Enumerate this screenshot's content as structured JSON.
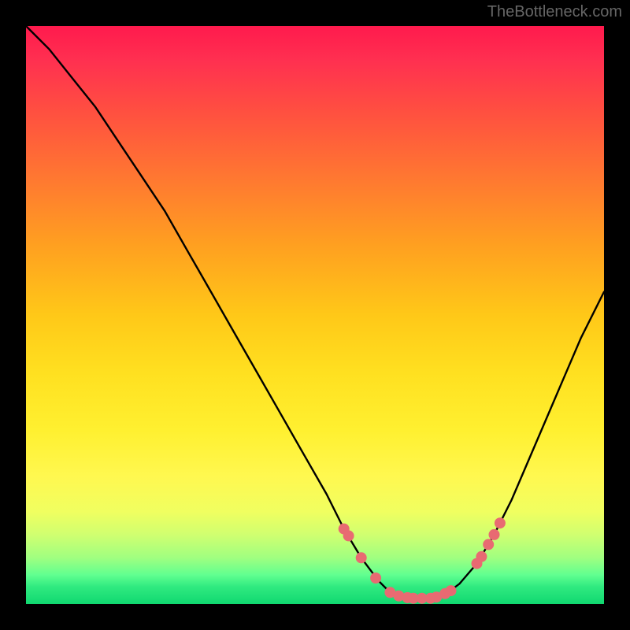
{
  "watermark": "TheBottleneck.com",
  "chart_data": {
    "type": "line",
    "title": "",
    "xlabel": "",
    "ylabel": "",
    "xlim": [
      0,
      100
    ],
    "ylim": [
      0,
      100
    ],
    "curve": {
      "name": "bottleneck-curve",
      "x": [
        0,
        4,
        8,
        12,
        16,
        20,
        24,
        28,
        32,
        36,
        40,
        44,
        48,
        52,
        55,
        58,
        61,
        63,
        65,
        67,
        69,
        71,
        73,
        75,
        78,
        81,
        84,
        87,
        90,
        93,
        96,
        100
      ],
      "y": [
        100,
        96,
        91,
        86,
        80,
        74,
        68,
        61,
        54,
        47,
        40,
        33,
        26,
        19,
        13,
        8,
        4,
        2,
        1.2,
        1,
        1,
        1.2,
        2,
        3.5,
        7,
        12,
        18,
        25,
        32,
        39,
        46,
        54
      ]
    },
    "markers": {
      "name": "highlight-dots",
      "color": "#e86a72",
      "x": [
        55.0,
        55.8,
        58.0,
        60.5,
        63.0,
        64.5,
        66.0,
        67.0,
        68.5,
        70.0,
        71.0,
        72.5,
        73.5,
        78.0,
        78.8,
        80.0,
        81.0,
        82.0
      ],
      "y": [
        13.0,
        11.8,
        8.0,
        4.5,
        2.0,
        1.4,
        1.1,
        1.0,
        1.0,
        1.0,
        1.2,
        1.8,
        2.3,
        7.0,
        8.2,
        10.3,
        12.0,
        14.0
      ]
    },
    "gradient_stops": [
      {
        "pos": 0.0,
        "color": "#ff1a4d"
      },
      {
        "pos": 0.15,
        "color": "#ff5040"
      },
      {
        "pos": 0.38,
        "color": "#ffa020"
      },
      {
        "pos": 0.6,
        "color": "#ffe020"
      },
      {
        "pos": 0.84,
        "color": "#d0ff70"
      },
      {
        "pos": 1.0,
        "color": "#10d870"
      }
    ]
  }
}
